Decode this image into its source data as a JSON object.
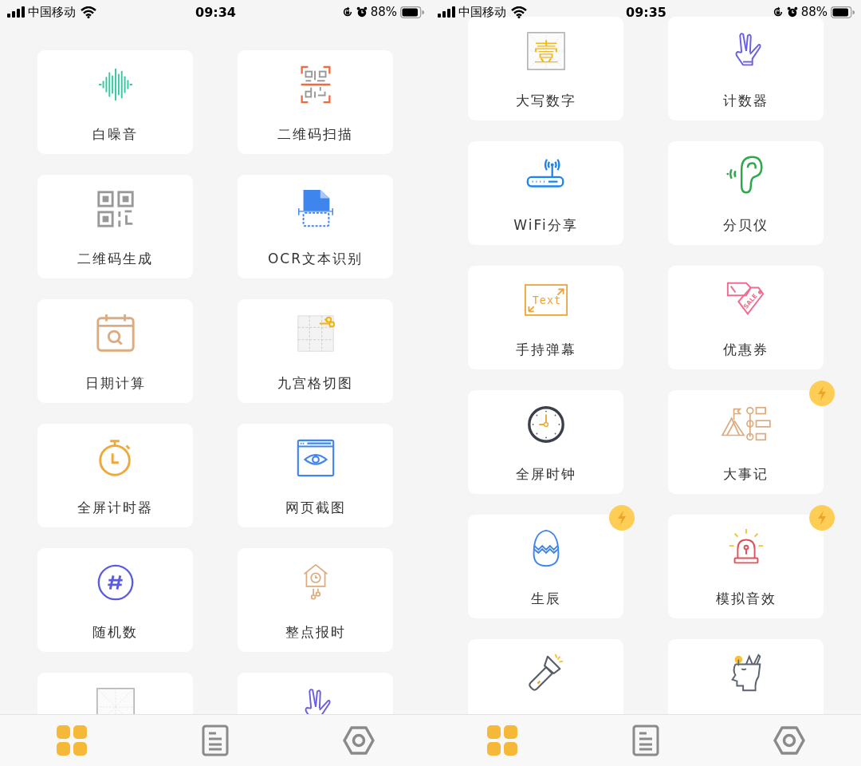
{
  "screens": [
    {
      "status_bar": {
        "carrier": "中国移动",
        "time": "09:34",
        "battery": "88%"
      },
      "cards": [
        {
          "label": "白噪音",
          "badge": false
        },
        {
          "label": "二维码扫描",
          "badge": false
        },
        {
          "label": "二维码生成",
          "badge": false
        },
        {
          "label": "OCR文本识别",
          "badge": false
        },
        {
          "label": "日期计算",
          "badge": false
        },
        {
          "label": "九宫格切图",
          "badge": false
        },
        {
          "label": "全屏计时器",
          "badge": false
        },
        {
          "label": "网页截图",
          "badge": false
        },
        {
          "label": "随机数",
          "badge": false
        },
        {
          "label": "整点报时",
          "badge": false
        },
        {
          "badge": false
        },
        {
          "badge": false
        }
      ],
      "tab_bar": [
        {
          "selected": true
        },
        {
          "selected": false
        },
        {
          "selected": false
        }
      ]
    },
    {
      "status_bar": {
        "carrier": "中国移动",
        "time": "09:35",
        "battery": "88%"
      },
      "cards": [
        {
          "label": "大写数字",
          "icon_text": "壹",
          "badge": false
        },
        {
          "label": "计数器",
          "badge": false
        },
        {
          "label": "WiFi分享",
          "badge": false
        },
        {
          "label": "分贝仪",
          "badge": false
        },
        {
          "label": "手持弹幕",
          "icon_text": "Text",
          "badge": false
        },
        {
          "label": "优惠券",
          "icon_text": "SALE",
          "badge": false
        },
        {
          "label": "全屏时钟",
          "badge": false
        },
        {
          "label": "大事记",
          "badge": true
        },
        {
          "label": "生辰",
          "badge": true
        },
        {
          "label": "模拟音效",
          "badge": true
        },
        {
          "badge": false
        },
        {
          "badge": false
        }
      ],
      "tab_bar": [
        {
          "selected": true
        },
        {
          "selected": false
        },
        {
          "selected": false
        }
      ]
    }
  ]
}
